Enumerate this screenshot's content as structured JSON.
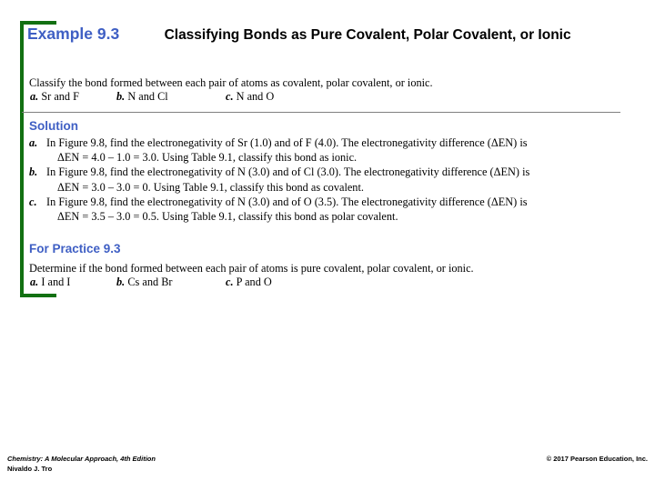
{
  "slide": {
    "accent_blue": "#3f5fc4",
    "bracket_green": "#127012",
    "divider_gray": "#808080"
  },
  "header": {
    "example_number": "Example 9.3",
    "title": "Classifying Bonds as Pure Covalent, Polar Covalent, or Ionic"
  },
  "problem": {
    "prompt": "Classify the bond formed between each pair of atoms as covalent, polar covalent, or ionic.",
    "choices": [
      {
        "label": "a.",
        "text": "Sr and F"
      },
      {
        "label": "b.",
        "text": "N and Cl"
      },
      {
        "label": "c.",
        "text": "N and O"
      }
    ]
  },
  "solution": {
    "heading": "Solution",
    "steps": [
      {
        "label": "a.",
        "line1": "In Figure 9.8, find the electronegativity of Sr (1.0) and of F (4.0). The electronegativity difference (ΔEN) is",
        "line2": "ΔEN = 4.0 – 1.0 = 3.0. Using Table 9.1, classify this bond as ionic."
      },
      {
        "label": "b.",
        "line1": "In Figure 9.8, find the electronegativity of N (3.0) and of Cl (3.0). The electronegativity difference (ΔEN) is",
        "line2": "ΔEN = 3.0 – 3.0 = 0. Using Table 9.1, classify this bond as covalent."
      },
      {
        "label": "c.",
        "line1": "In Figure 9.8, find the electronegativity of N (3.0) and of O (3.5). The electronegativity difference (ΔEN) is",
        "line2": "ΔEN = 3.5 – 3.0 = 0.5. Using Table 9.1, classify this bond as polar covalent."
      }
    ]
  },
  "practice": {
    "heading": "For Practice 9.3",
    "prompt": "Determine if the bond formed between each pair of atoms is pure covalent, polar covalent, or ionic.",
    "choices": [
      {
        "label": "a.",
        "text": "I and I"
      },
      {
        "label": "b.",
        "text": "Cs and Br"
      },
      {
        "label": "c.",
        "text": "P and O"
      }
    ]
  },
  "footer": {
    "book": "Chemistry: A Molecular Approach, 4th Edition",
    "author": "Nivaldo J. Tro",
    "copyright": "© 2017 Pearson Education, Inc."
  }
}
